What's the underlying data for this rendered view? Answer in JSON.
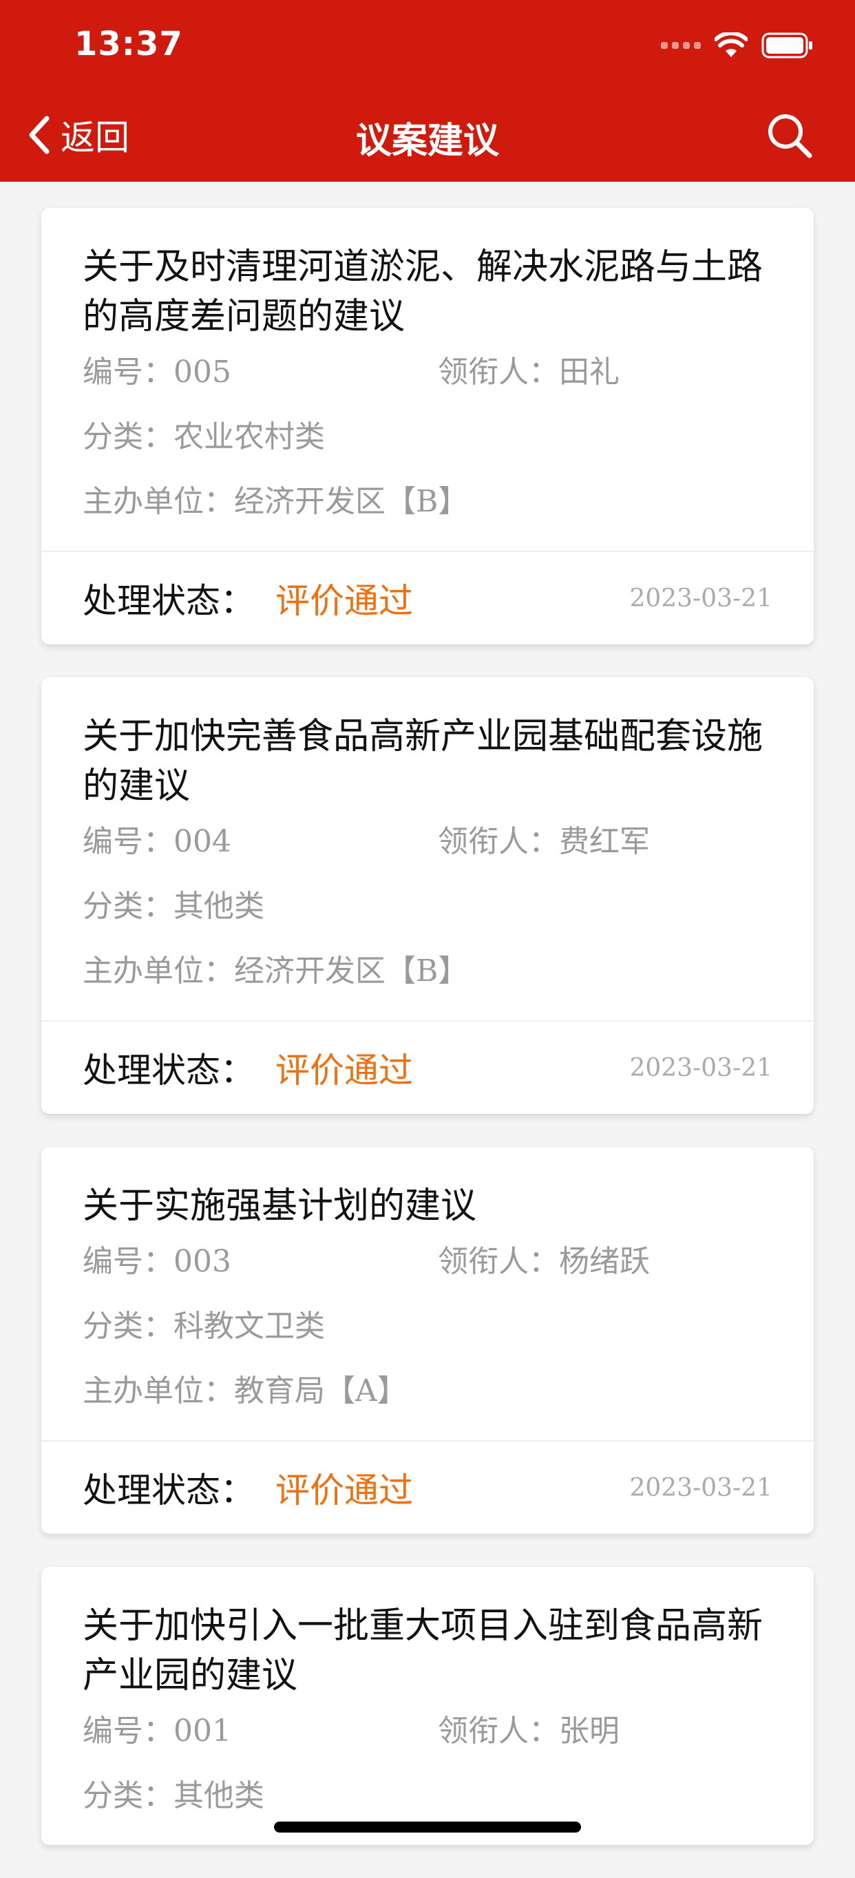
{
  "status_bar": {
    "time": "13:37"
  },
  "nav": {
    "back_label": "返回",
    "title": "议案建议"
  },
  "labels": {
    "number": "编号：",
    "leader": "领衔人：",
    "category": "分类：",
    "unit": "主办单位：",
    "status": "处理状态："
  },
  "items": [
    {
      "title": "关于及时清理河道淤泥、解决水泥路与土路的高度差问题的建议",
      "number": "005",
      "leader": "田礼",
      "category": "农业农村类",
      "unit": "经济开发区【B】",
      "status": "评价通过",
      "date": "2023-03-21"
    },
    {
      "title": "关于加快完善食品高新产业园基础配套设施的建议",
      "number": "004",
      "leader": "费红军",
      "category": "其他类",
      "unit": "经济开发区【B】",
      "status": "评价通过",
      "date": "2023-03-21"
    },
    {
      "title": "关于实施强基计划的建议",
      "number": "003",
      "leader": "杨绪跃",
      "category": "科教文卫类",
      "unit": "教育局【A】",
      "status": "评价通过",
      "date": "2023-03-21"
    },
    {
      "title": "关于加快引入一批重大项目入驻到食品高新产业园的建议",
      "number": "001",
      "leader": "张明",
      "category": "其他类",
      "unit": "",
      "status": "",
      "date": ""
    }
  ],
  "colors": {
    "header_bg": "#d01a0d",
    "status_accent": "#f07010"
  }
}
